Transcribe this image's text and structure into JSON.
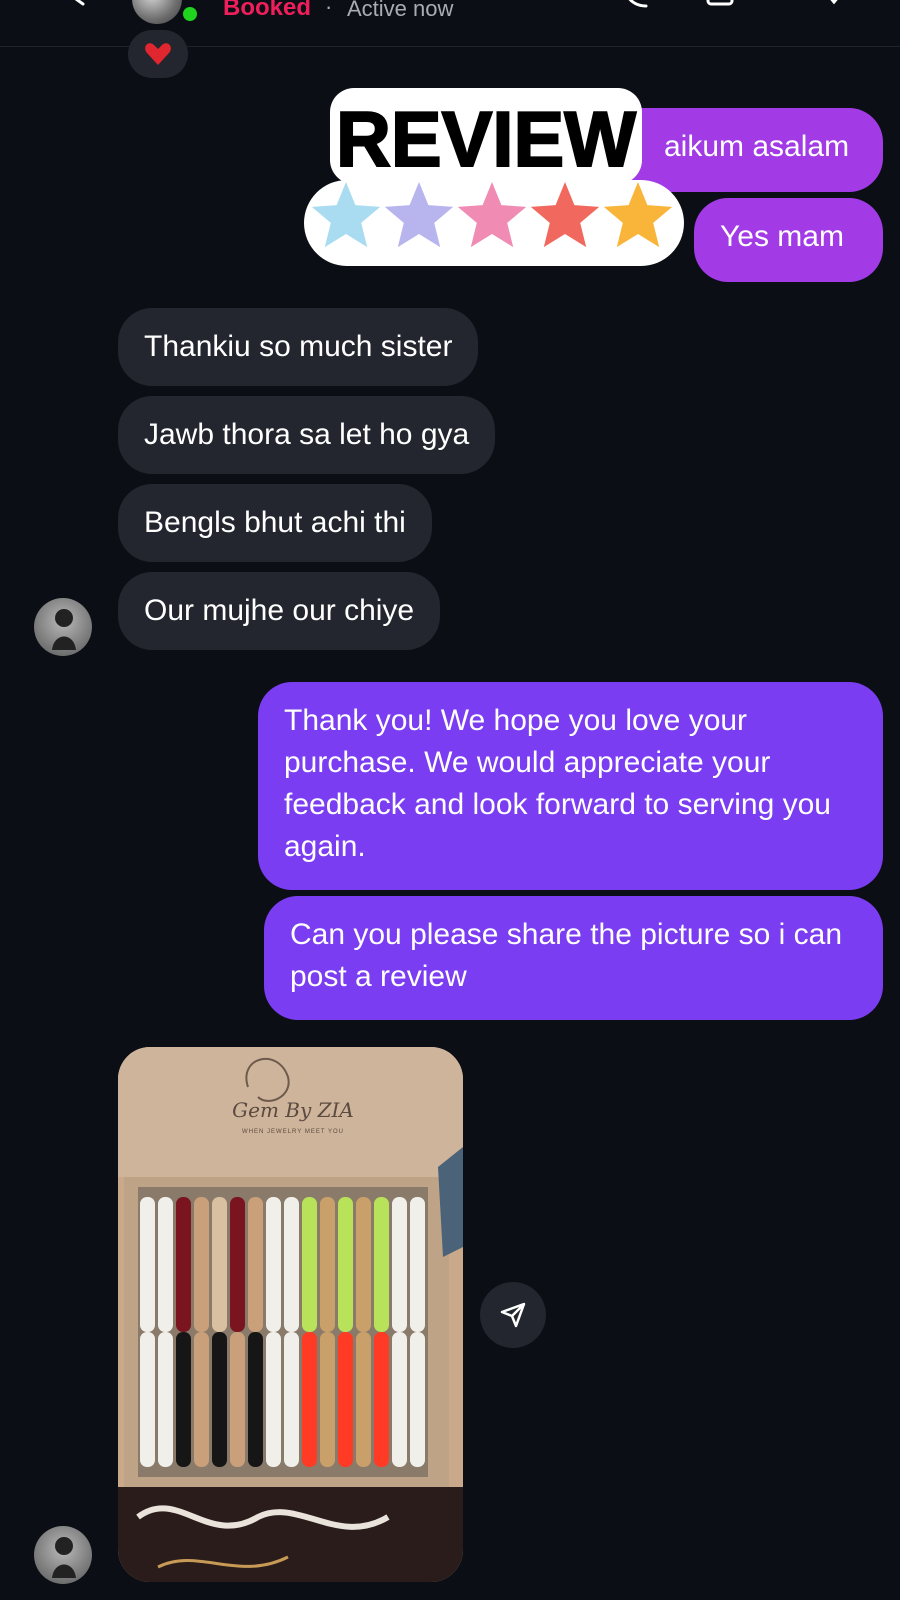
{
  "header": {
    "name": "Booked",
    "separator": "·",
    "status": "Active now"
  },
  "reaction": {
    "icon": "heart-icon",
    "color": "#e0262e"
  },
  "sticker": {
    "text": "REVIEW",
    "star_colors": [
      "#a9dcf0",
      "#b7b4ee",
      "#f08bb3",
      "#f0685e",
      "#f8b53a"
    ]
  },
  "messages": {
    "sent_top": [
      "aikum asalam",
      "Yes mam"
    ],
    "received": [
      "Thankiu so much sister",
      "Jawb thora sa let ho gya",
      "Bengls bhut achi thi",
      "Our mujhe our chiye"
    ],
    "sent_bottom": [
      "Thank you! We hope you love your purchase. We would appreciate your feedback and look forward to serving you again.",
      "Can you please share the picture so i can post a review"
    ]
  },
  "photo": {
    "box_logo_text": "Gem By ZIA",
    "box_tagline": "WHEN JEWELRY MEET YOU"
  },
  "colors": {
    "background": "#0b0e15",
    "incoming_bubble": "#23262e",
    "outgoing_magenta": "#a23be6",
    "outgoing_violet": "#7b3df2",
    "name_accent": "#f01e5a",
    "online": "#1fd31f"
  }
}
